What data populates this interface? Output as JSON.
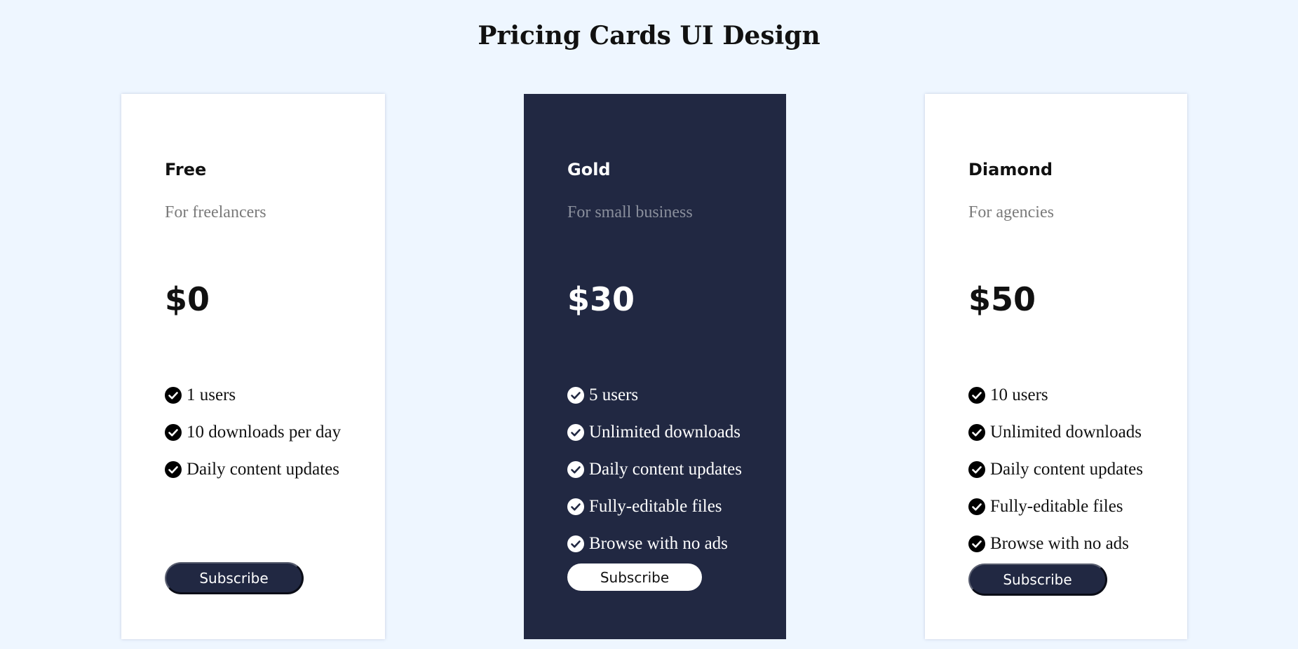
{
  "page": {
    "title": "Pricing Cards UI Design"
  },
  "colors": {
    "background": "#eef6ff",
    "card_light": "#ffffff",
    "card_dark": "#212842",
    "button_dark": "#212842",
    "text_muted": "#7a7a7a"
  },
  "plans": [
    {
      "name": "Free",
      "description": "For freelancers",
      "price": "$0",
      "features": [
        "1 users",
        "10 downloads per day",
        "Daily content updates"
      ],
      "button_label": "Subscribe",
      "feature_icon": "check-circle-icon"
    },
    {
      "name": "Gold",
      "description": "For small business",
      "price": "$30",
      "features": [
        "5 users",
        "Unlimited downloads",
        "Daily content updates",
        "Fully-editable files",
        "Browse with no ads"
      ],
      "button_label": "Subscribe",
      "feature_icon": "check-circle-icon"
    },
    {
      "name": "Diamond",
      "description": "For agencies",
      "price": "$50",
      "features": [
        "10 users",
        "Unlimited downloads",
        "Daily content updates",
        "Fully-editable files",
        "Browse with no ads"
      ],
      "button_label": "Subscribe",
      "feature_icon": "check-circle-icon"
    }
  ]
}
